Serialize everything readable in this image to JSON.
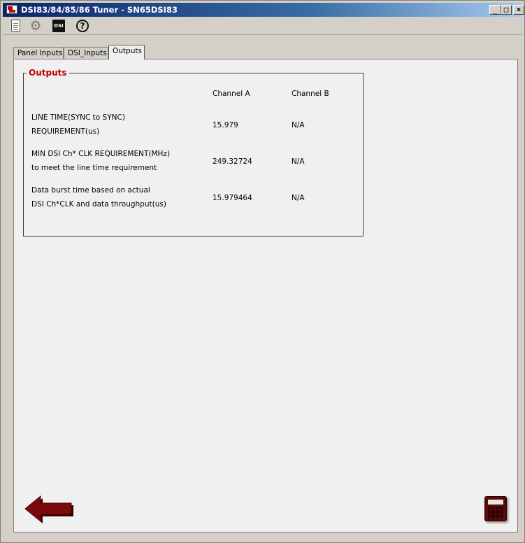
{
  "window": {
    "title": "DSI83/84/85/86 Tuner - SN65DSI83",
    "controls": {
      "minimize": "_",
      "maximize": "□",
      "close": "×"
    }
  },
  "toolbar": {
    "icons": [
      "document-icon",
      "gear-icon",
      "dsi-icon",
      "help-icon"
    ],
    "dsi_label": "DSI",
    "help_label": "?",
    "gear_glyph": "⚙"
  },
  "tabs": [
    {
      "label": "Panel Inputs",
      "active": false
    },
    {
      "label": "DSI_Inputs",
      "active": false
    },
    {
      "label": "Outputs",
      "active": true
    }
  ],
  "outputs": {
    "title": "Outputs",
    "columns": [
      "Channel A",
      "Channel B"
    ],
    "rows": [
      {
        "label_line1": "LINE TIME(SYNC to SYNC)",
        "label_line2": "REQUIREMENT(us)",
        "channel_a": "15.979",
        "channel_b": "N/A"
      },
      {
        "label_line1": "MIN DSI Ch* CLK REQUIREMENT(MHz)",
        "label_line2": "to meet the line time requirement",
        "channel_a": "249.32724",
        "channel_b": "N/A"
      },
      {
        "label_line1": "Data burst time based on actual",
        "label_line2": "DSI Ch*CLK and data throughput(us)",
        "channel_a": "15.979464",
        "channel_b": "N/A"
      }
    ]
  },
  "buttons": {
    "back": "back-arrow-icon",
    "calculate": "calculator-icon"
  },
  "colors": {
    "title_gradient_start": "#0a246a",
    "accent_red": "#c00000",
    "arrow_red": "#7a0a0a"
  }
}
